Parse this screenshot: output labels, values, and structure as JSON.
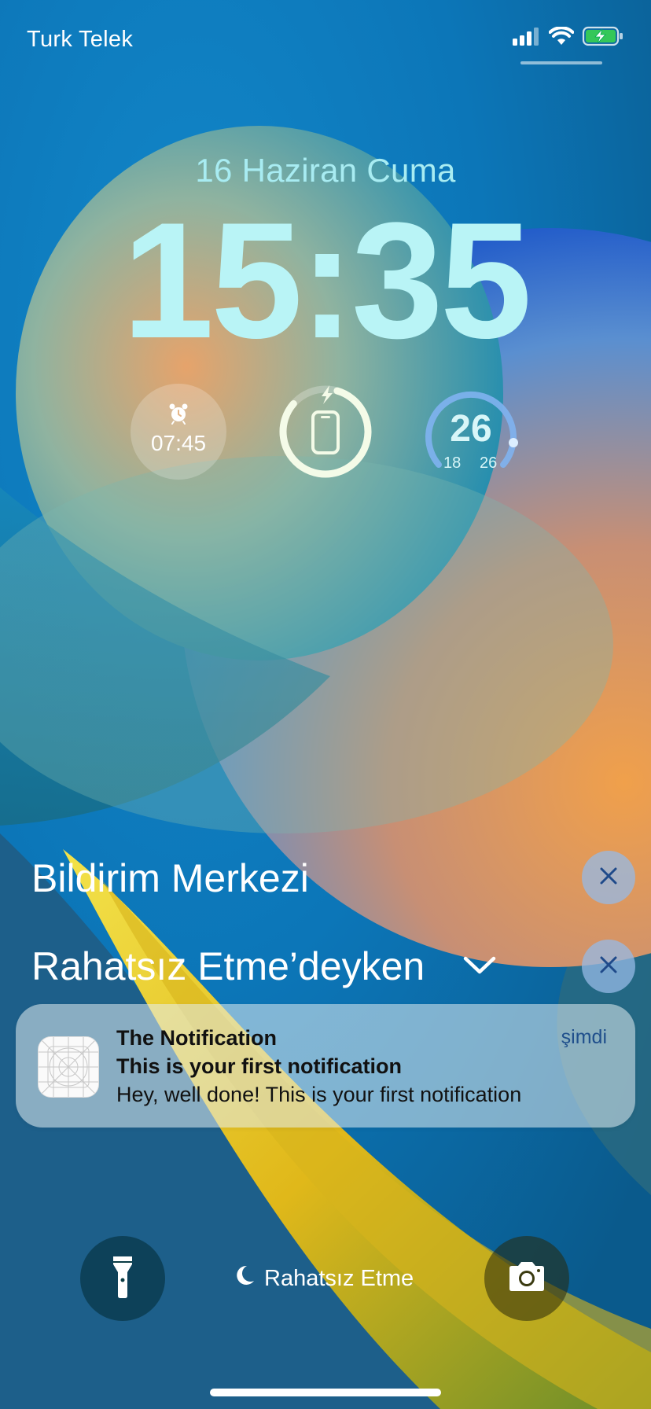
{
  "status_bar": {
    "carrier": "Turk Telek",
    "signal_icon": "cellular-signal-icon",
    "wifi_icon": "wifi-icon",
    "battery_icon": "battery-charging-icon",
    "battery_color": "#34c759"
  },
  "lock_screen": {
    "date": "16 Haziran Cuma",
    "time": "15:35"
  },
  "widgets": {
    "alarm": {
      "icon": "alarm-clock-icon",
      "time": "07:45"
    },
    "battery": {
      "icon": "iphone-icon",
      "charging_icon": "bolt-icon",
      "level_fraction": 0.9
    },
    "weather": {
      "current": "26",
      "low": "18",
      "high": "26"
    }
  },
  "notification_center": {
    "title": "Bildirim Merkezi",
    "dnd_section": "Rahatsız Etme’deyken",
    "clear_icon": "close-icon",
    "expand_icon": "chevron-down-icon"
  },
  "notification": {
    "app_name": "The Notification",
    "time": "şimdi",
    "title": "This is your first notification",
    "body": "Hey, well done! This is your first notification"
  },
  "bottom_bar": {
    "flashlight_icon": "flashlight-icon",
    "dnd_icon": "moon-icon",
    "dnd_label": "Rahatsız Etme",
    "camera_icon": "camera-icon"
  },
  "colors": {
    "time_color": "#b9f4f6",
    "date_color": "#a8ecf2",
    "accent_link": "#1f4f8c"
  }
}
